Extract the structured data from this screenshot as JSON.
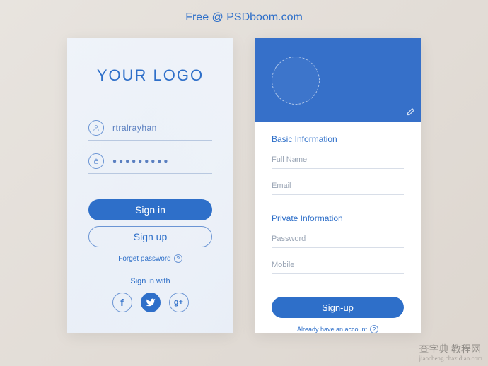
{
  "header": "Free @ PSDboom.com",
  "left": {
    "logo": "YOUR LOGO",
    "username": "rtralrayhan",
    "password_mask": "●●●●●●●●●",
    "signin": "Sign in",
    "signup": "Sign up",
    "forgot": "Forget password",
    "signin_with": "Sign in with",
    "social": {
      "fb": "f",
      "tw": "❯",
      "gp": "g+"
    }
  },
  "right": {
    "basic_label": "Basic Information",
    "fullname_ph": "Full Name",
    "email_ph": "Email",
    "private_label": "Private Information",
    "password_ph": "Password",
    "mobile_ph": "Mobile",
    "signup": "Sign-up",
    "already": "Already have an account"
  },
  "watermark": {
    "main": "查字典 教程网",
    "sub": "jiaocheng.chazidian.com"
  }
}
